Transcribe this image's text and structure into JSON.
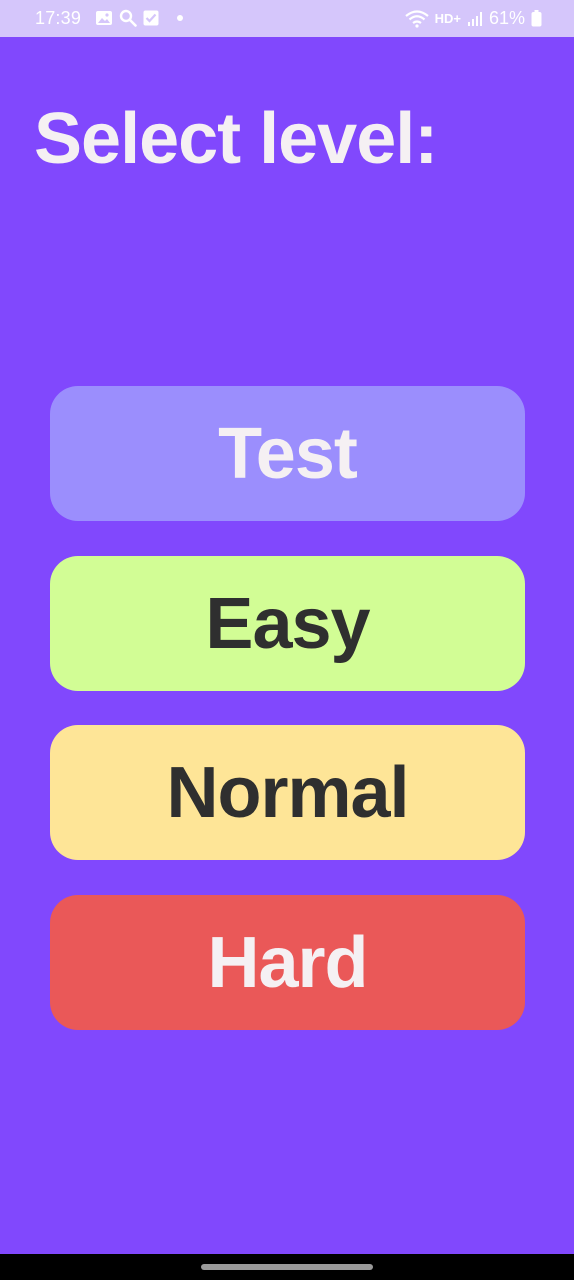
{
  "status_bar": {
    "time": "17:39",
    "left_icons": [
      "image-icon",
      "search-icon",
      "checkbox-icon",
      "notification-dot"
    ],
    "hd_label": "HD+",
    "battery_text": "61%",
    "right_icons": [
      "wifi-icon",
      "hd-plus-icon",
      "signal-icon",
      "battery-icon"
    ]
  },
  "screen": {
    "title": "Select level:"
  },
  "levels": [
    {
      "label": "Test",
      "bg_color": "#9b8efd",
      "text_color": "#f5f0f3"
    },
    {
      "label": "Easy",
      "bg_color": "#d2fd95",
      "text_color": "#2f2f2f"
    },
    {
      "label": "Normal",
      "bg_color": "#fee597",
      "text_color": "#2f2f2f"
    },
    {
      "label": "Hard",
      "bg_color": "#ea5858",
      "text_color": "#f5f0f3"
    }
  ],
  "colors": {
    "background": "#8148fd",
    "status_bar": "#d5c6fb",
    "title_text": "#f5f0f3"
  }
}
